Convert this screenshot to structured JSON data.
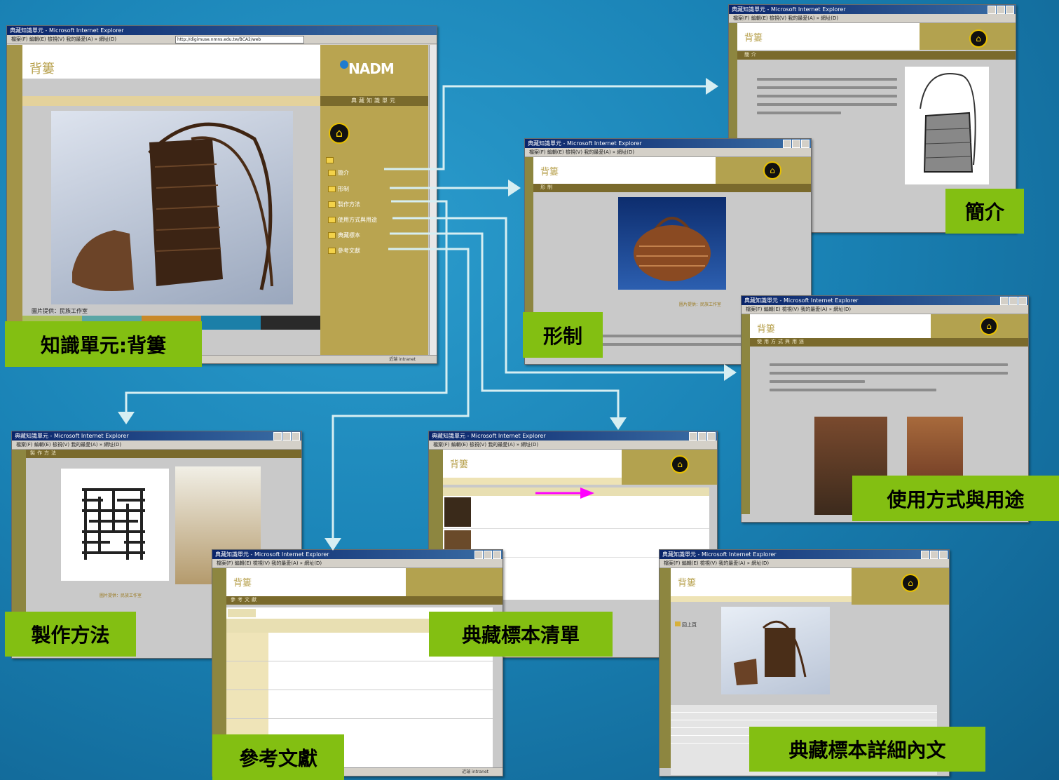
{
  "labels": {
    "main": "知識單元:背簍",
    "intro": "簡介",
    "form": "形制",
    "usage": "使用方式與用途",
    "making": "製作方法",
    "refs": "參考文獻",
    "list": "典藏標本清單",
    "detail": "典藏標本詳細內文"
  },
  "main_window": {
    "title": "典藏知識單元 - Microsoft Internet Explorer",
    "menubar": "檔案(F)  編輯(E)  檢視(V)  我的最愛(A)  »  網址(D)",
    "address": "http://digimuse.nmns.edu.tw/BCA2/web",
    "page_title": "背簍",
    "logo_text": "NADM",
    "section_header": "典藏知識單元",
    "caption": "圖片提供：民族工作室",
    "status": "近端 intranet",
    "menu_items": [
      "簡介",
      "形制",
      "製作方法",
      "使用方式與用途",
      "典藏標本",
      "參考文獻"
    ]
  },
  "intro_window": {
    "page_title": "背簍",
    "section": "簡介",
    "section_header": "典藏知識單元"
  },
  "form_window": {
    "page_title": "背簍",
    "section": "形制",
    "section_header": "典藏知識單元",
    "caption": "圖片提供：民族工作室"
  },
  "usage_window": {
    "page_title": "背簍",
    "section": "使用方式與用途",
    "section_header": "典藏知識單元"
  },
  "making_window": {
    "section": "製作方法",
    "section_header": "典藏知識單元",
    "caption": "圖片提供：民族工作室"
  },
  "refs_window": {
    "page_title": "背簍",
    "section": "參考文獻",
    "status": "近端 intranet"
  },
  "list_window": {
    "page_title": "背簍",
    "section_header": "典藏知識單元"
  },
  "detail_window": {
    "page_title": "背簍",
    "section_header": "典藏知識單元",
    "back_label": "回上頁"
  },
  "colors": {
    "background": "#1a83b6",
    "tag": "#83bf12",
    "gold": "#b3a24f",
    "arrow": "#d6eef2",
    "magenta_arrow": "#ff00ff"
  }
}
